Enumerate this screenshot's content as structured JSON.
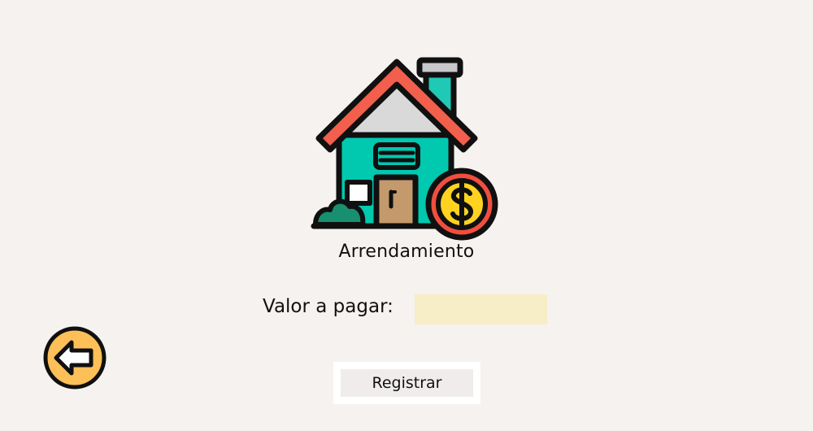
{
  "illustration": {
    "icon": "house-with-dollar-coin-icon",
    "colors": {
      "roof": "#f25f4c",
      "roof_inner": "#d9d9d9",
      "chimney": "#1fc9b5",
      "wall": "#00c9b0",
      "door": "#c49a6c",
      "coin_outer": "#f04e3e",
      "coin_inner": "#ffd21f",
      "bush": "#188f6f",
      "outline": "#101010"
    }
  },
  "title": "Arrendamiento",
  "form": {
    "amount_label": "Valor a pagar:",
    "amount_value": "",
    "amount_input_color": "#f7edc6"
  },
  "actions": {
    "register_label": "Registrar",
    "back_icon": "arrow-left-icon",
    "back_color": "#fdbf57"
  },
  "background": "#f5f2ef"
}
